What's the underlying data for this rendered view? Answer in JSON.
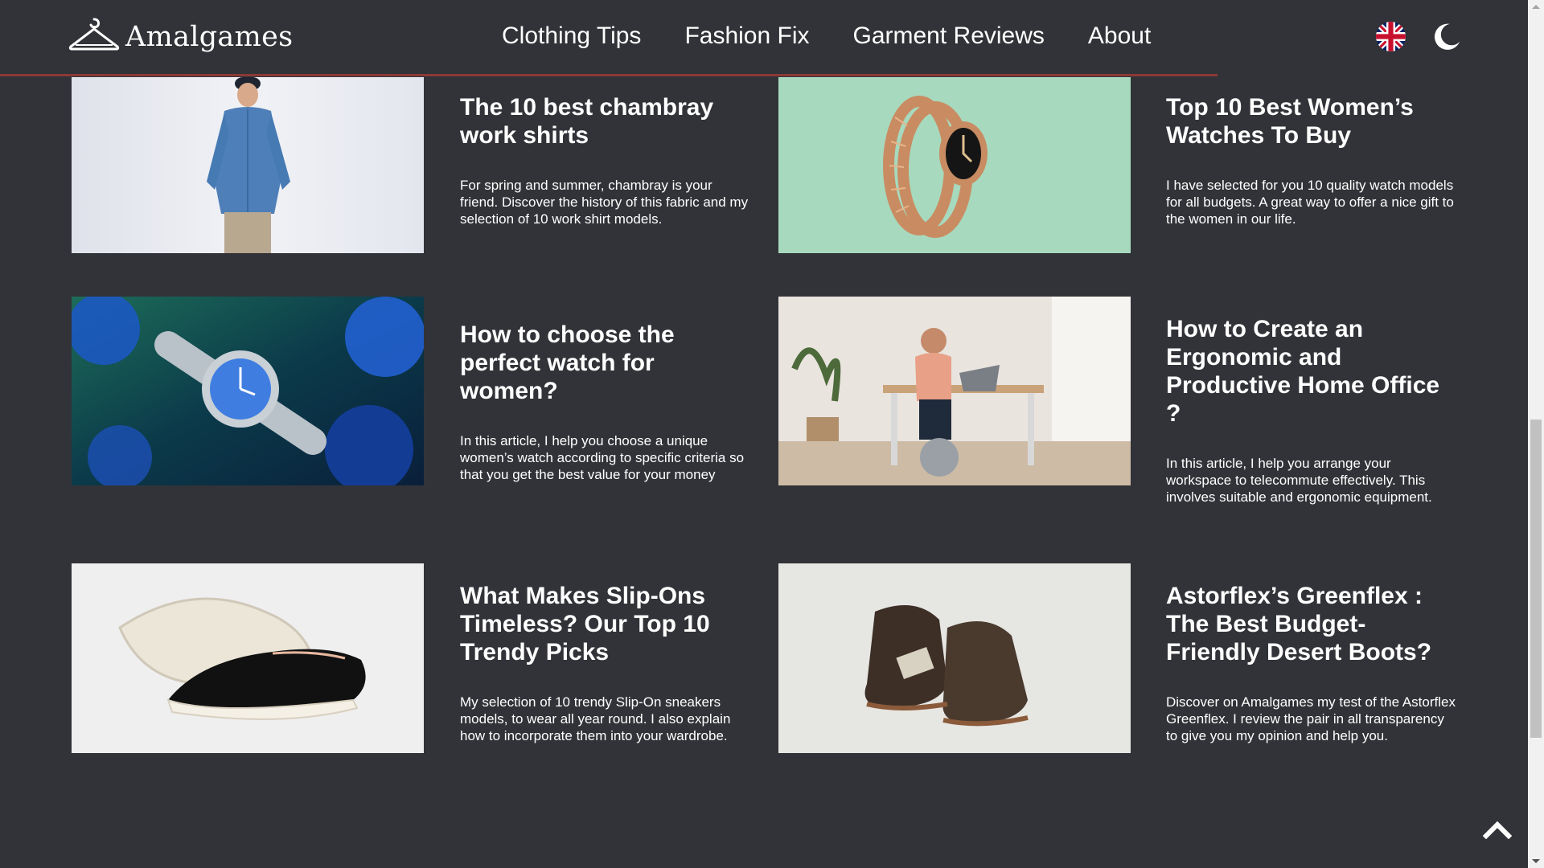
{
  "site": {
    "name": "Amalgames",
    "logo_icon": "hanger-icon"
  },
  "nav": {
    "items": [
      {
        "label": "Clothing Tips"
      },
      {
        "label": "Fashion Fix"
      },
      {
        "label": "Garment Reviews"
      },
      {
        "label": "About"
      }
    ]
  },
  "header_icons": {
    "language": "uk-flag-icon",
    "theme": "moon-icon"
  },
  "articles": [
    {
      "title": "The 10 best chambray work shirts",
      "excerpt": "For spring and summer, chambray is your friend. Discover the history of this fabric and my selection of 10 work shirt models.",
      "image": "man-in-chambray-shirt-image"
    },
    {
      "title": "Top 10 Best Women’s Watches To Buy",
      "excerpt": "I have selected for you 10 quality watch models for all budgets. A great way to offer a nice gift to the women in our life.",
      "image": "gold-serpent-watch-image"
    },
    {
      "title": "How to choose the perfect watch for women?",
      "excerpt": "In this article, I help you choose a unique women’s watch according to specific criteria so that you get the best value for your money",
      "image": "watch-on-blue-flowers-image"
    },
    {
      "title": "How to Create an Ergonomic and Productive Home Office ?",
      "excerpt": "In this article, I help you arrange your workspace to telecommute effectively. This involves suitable and ergonomic equipment.",
      "image": "man-at-standing-desk-image"
    },
    {
      "title": "What Makes Slip-Ons Timeless? Our Top 10 Trendy Picks",
      "excerpt": "My selection of 10 trendy Slip-On sneakers models, to wear all year round. I also explain how to incorporate them into your wardrobe.",
      "image": "black-slip-on-sneakers-image"
    },
    {
      "title": "Astorflex’s Greenflex : The Best Budget-Friendly Desert Boots?",
      "excerpt": "Discover on Amalgames my test of the Astorflex Greenflex. I review the pair in all transparency to give you my opinion and help you.",
      "image": "brown-desert-boots-image"
    }
  ],
  "colors": {
    "background": "#323338",
    "accent_rule": "#8a3a36",
    "text": "#ffffff"
  },
  "back_to_top": "chevron-up-icon"
}
